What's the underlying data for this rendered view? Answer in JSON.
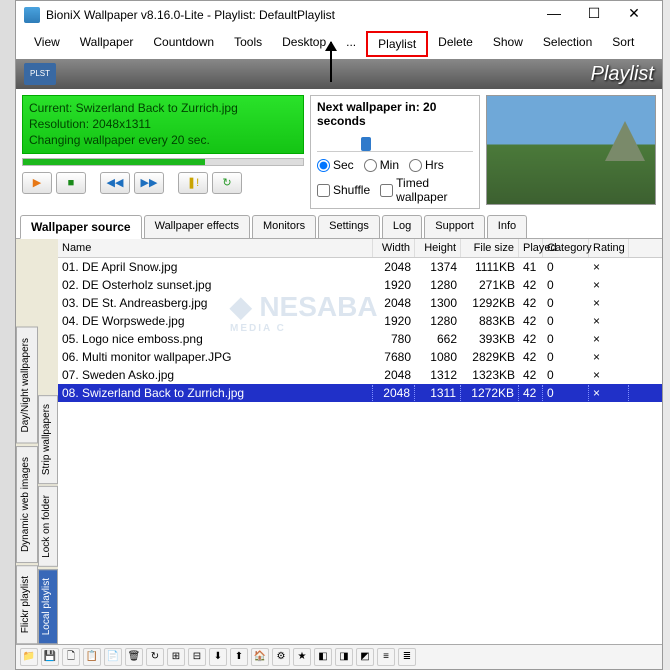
{
  "titlebar": {
    "title": "BioniX Wallpaper v8.16.0-Lite - Playlist: DefaultPlaylist"
  },
  "menu": [
    "View",
    "Wallpaper",
    "Countdown",
    "Tools",
    "Desktop",
    "...",
    "Playlist",
    "Delete",
    "Show",
    "Selection",
    "Sort"
  ],
  "menu_highlight_index": 6,
  "banner": {
    "plst": "PLST",
    "brand": "Playlist"
  },
  "status": {
    "line1": "Current: Swizerland Back to Zurrich.jpg",
    "line2": "Resolution:  2048x1311",
    "line3": "Changing wallpaper every 20 sec."
  },
  "player": {
    "play": "▶",
    "stop": "■",
    "prev": "◀◀",
    "next": "▶▶",
    "warn": "❚!",
    "refresh": "↻"
  },
  "next": {
    "header_pre": "Next wallpaper in: ",
    "header_val": "20 seconds",
    "radios": [
      "Sec",
      "Min",
      "Hrs"
    ],
    "radio_sel": 0,
    "checks": [
      "Shuffle",
      "Timed wallpaper"
    ]
  },
  "tabs": [
    "Wallpaper source",
    "Wallpaper effects",
    "Monitors",
    "Settings",
    "Log",
    "Support",
    "Info"
  ],
  "tabs_active": 0,
  "outer_sidetabs": [
    "Flickr playlist",
    "Dynamic web images",
    "Day/Night wallpapers"
  ],
  "inner_sidetabs": [
    "Local playlist",
    "Lock on folder",
    "Strip wallpapers"
  ],
  "inner_active": 0,
  "columns": [
    "Name",
    "Width",
    "Height",
    "File size",
    "Played",
    "Category",
    "Rating"
  ],
  "rows": [
    {
      "name": "01. DE April Snow.jpg",
      "w": "2048",
      "h": "1374",
      "fs": "1111KB",
      "pl": "41",
      "cat": "0",
      "rat": "×"
    },
    {
      "name": "02. DE Osterholz sunset.jpg",
      "w": "1920",
      "h": "1280",
      "fs": "271KB",
      "pl": "42",
      "cat": "0",
      "rat": "×"
    },
    {
      "name": "03. DE St. Andreasberg.jpg",
      "w": "2048",
      "h": "1300",
      "fs": "1292KB",
      "pl": "42",
      "cat": "0",
      "rat": "×"
    },
    {
      "name": "04. DE Worpswede.jpg",
      "w": "1920",
      "h": "1280",
      "fs": "883KB",
      "pl": "42",
      "cat": "0",
      "rat": "×"
    },
    {
      "name": "05. Logo nice emboss.png",
      "w": "780",
      "h": "662",
      "fs": "393KB",
      "pl": "42",
      "cat": "0",
      "rat": "×"
    },
    {
      "name": "06. Multi monitor wallpaper.JPG",
      "w": "7680",
      "h": "1080",
      "fs": "2829KB",
      "pl": "42",
      "cat": "0",
      "rat": "×"
    },
    {
      "name": "07. Sweden Asko.jpg",
      "w": "2048",
      "h": "1312",
      "fs": "1323KB",
      "pl": "42",
      "cat": "0",
      "rat": "×"
    },
    {
      "name": "08. Swizerland Back to Zurrich.jpg",
      "w": "2048",
      "h": "1311",
      "fs": "1272KB",
      "pl": "42",
      "cat": "0",
      "rat": "×"
    }
  ],
  "row_selected": 7,
  "bottom_icons": [
    "📁",
    "💾",
    "🗋",
    "📋",
    "📄",
    "🗑",
    "↻",
    "⊞",
    "⊟",
    "⬇",
    "⬆",
    "🏠",
    "⚙",
    "★",
    "◧",
    "◨",
    "◩",
    "≡",
    "≣"
  ]
}
